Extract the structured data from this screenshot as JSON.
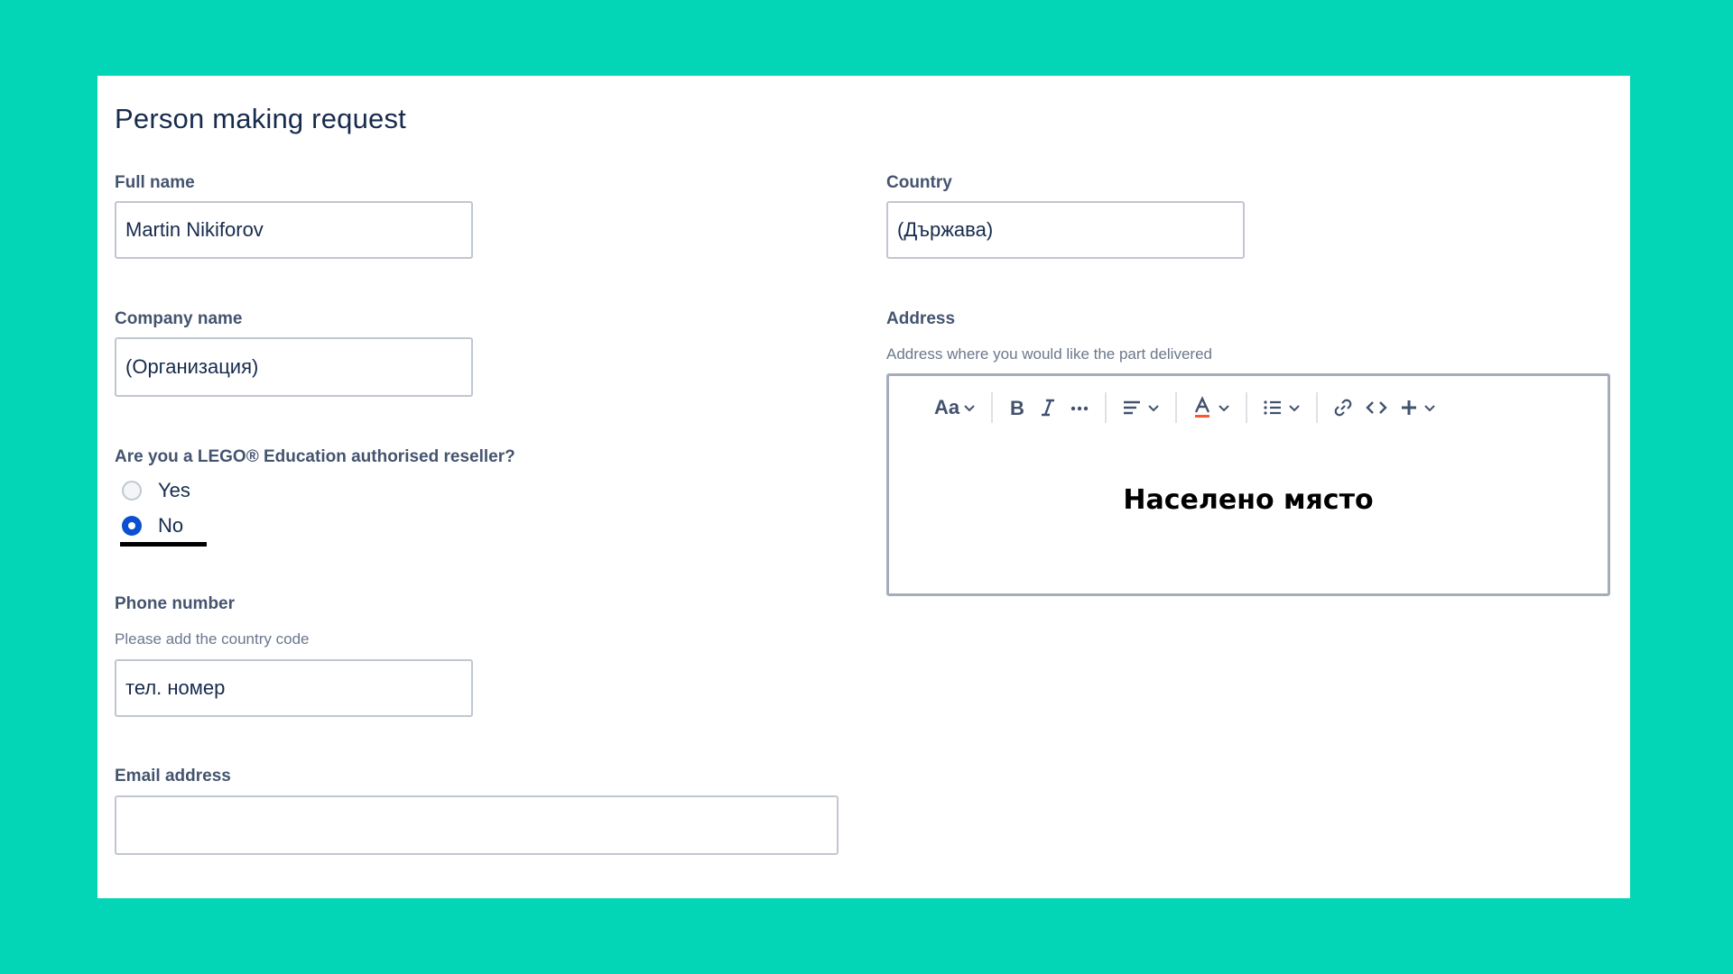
{
  "form": {
    "title": "Person making request",
    "full_name": {
      "label": "Full name",
      "value": "Martin Nikiforov"
    },
    "company_name": {
      "label": "Company name",
      "value": "(Организация)"
    },
    "reseller": {
      "question": "Are you a LEGO® Education authorised reseller?",
      "options": [
        {
          "label": "Yes",
          "checked": false
        },
        {
          "label": "No",
          "checked": true
        }
      ]
    },
    "phone": {
      "label": "Phone number",
      "help": "Please add the country code",
      "value": "тел. номер"
    },
    "email": {
      "label": "Email address",
      "value": ""
    },
    "country": {
      "label": "Country",
      "value": "(Държава)"
    },
    "address": {
      "label": "Address",
      "help": "Address where you would like the part delivered",
      "content": "Населено място",
      "toolbar": {
        "text_style_label": "Aa",
        "icons": [
          "text-style-icon",
          "bold-icon",
          "italic-icon",
          "more-icon",
          "align-icon",
          "text-color-icon",
          "list-icon",
          "link-icon",
          "code-icon",
          "insert-icon"
        ]
      }
    }
  },
  "colors": {
    "background": "#03d6b6",
    "radio_checked": "#0c4fd0",
    "text": "#172b4d",
    "label": "#44546f"
  }
}
